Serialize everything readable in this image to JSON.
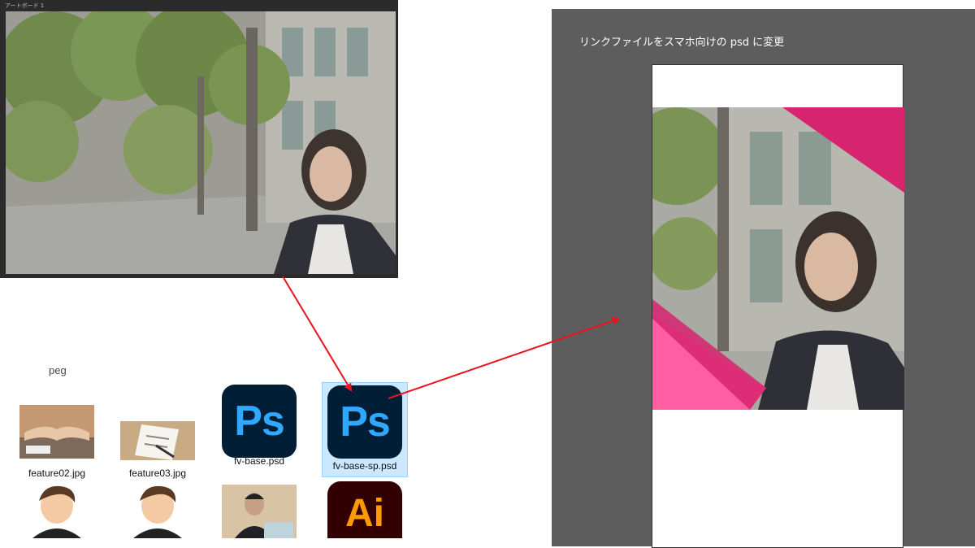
{
  "artboard": {
    "title": "アートボード 1"
  },
  "sp_panel": {
    "caption": "リンクファイルをスマホ向けの psd に変更"
  },
  "explorer": {
    "cut_label": "peg",
    "files": [
      {
        "name": "feature02.jpg",
        "icon": "handshake-thumbnail"
      },
      {
        "name": "feature03.jpg",
        "icon": "checklist-thumbnail"
      },
      {
        "name": "fv-base.psd",
        "icon": "photoshop-icon"
      },
      {
        "name": "fv-base-sp.psd",
        "icon": "photoshop-icon",
        "selected": true
      },
      {
        "name": "",
        "icon": "avatar-thumbnail"
      },
      {
        "name": "",
        "icon": "avatar-thumbnail"
      },
      {
        "name": "",
        "icon": "person-laptop-thumbnail"
      },
      {
        "name": "",
        "icon": "illustrator-icon"
      }
    ],
    "ps_label": "Ps",
    "ai_label": "Ai"
  },
  "colors": {
    "arrow": "#e8141f",
    "accent_pink": "#ff5fa2",
    "accent_magenta": "#d6246e",
    "panel": "#5d5d5d",
    "selection": "#cce8ff"
  }
}
